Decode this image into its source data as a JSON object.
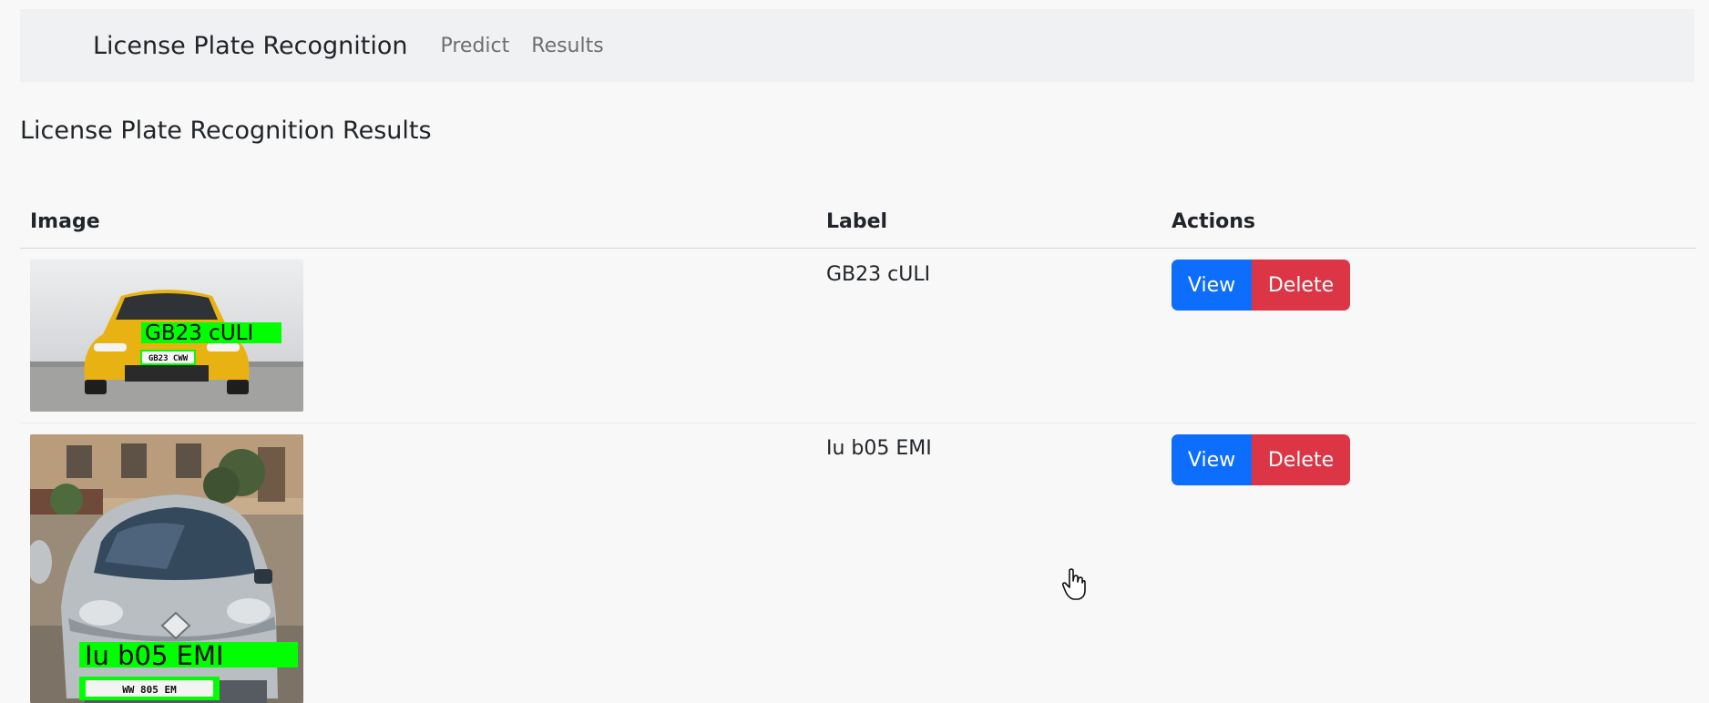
{
  "navbar": {
    "brand": "License Plate Recognition",
    "links": [
      "Predict",
      "Results"
    ]
  },
  "page": {
    "title": "License Plate Recognition Results"
  },
  "table": {
    "headers": [
      "Image",
      "Label",
      "Actions"
    ],
    "rows": [
      {
        "label": "GB23 cULI",
        "image_overlay_text": "GB23 cULI",
        "plate_text": "GB23 CWW",
        "actions": [
          "View",
          "Delete"
        ]
      },
      {
        "label": "Iu b05 EMI",
        "image_overlay_text": "Iu b05 EMI",
        "plate_text": "WW 805 EM",
        "actions": [
          "View",
          "Delete"
        ]
      }
    ]
  },
  "colors": {
    "primary": "#0d6efd",
    "danger": "#dc3545",
    "detection_box": "#00ff00"
  }
}
